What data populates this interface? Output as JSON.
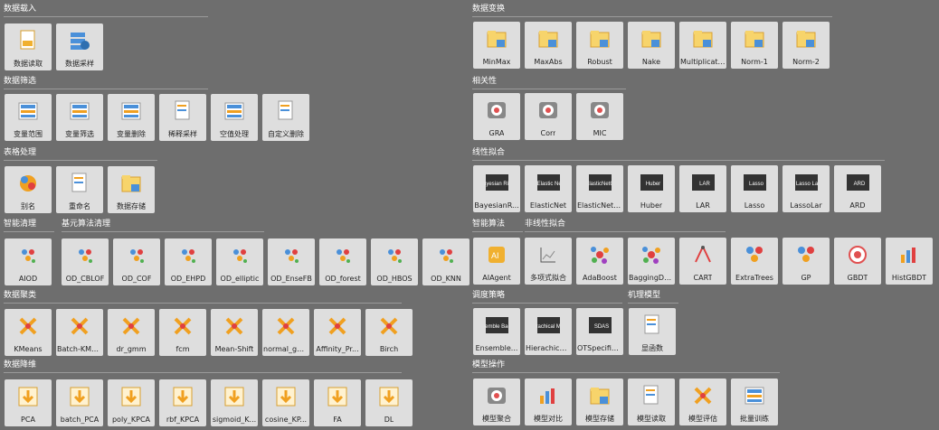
{
  "sections": {
    "load": {
      "title": "数据载入",
      "items": [
        "数据读取",
        "数据采样"
      ]
    },
    "filter": {
      "title": "数据筛选",
      "items": [
        "变量范围",
        "变量筛选",
        "变量删除",
        "稀释采样",
        "空值处理",
        "自定义删除"
      ]
    },
    "table": {
      "title": "表格处理",
      "items": [
        "别名",
        "重命名",
        "数据存储"
      ]
    },
    "smartclean": {
      "title": "智能清理",
      "items": [
        "AIOD"
      ]
    },
    "basecalc": {
      "title": "基元算法清理",
      "items": [
        "OD_CBLOF",
        "OD_COF",
        "OD_EHPD",
        "OD_elliptic",
        "OD_EnseFB",
        "OD_forest",
        "OD_HBOS",
        "OD_KNN"
      ]
    },
    "cluster": {
      "title": "数据聚类",
      "items": [
        "KMeans",
        "Batch-KMe...",
        "dr_gmm",
        "fcm",
        "Mean-Shift",
        "normal_gmm",
        "Affinity_Pr...",
        "Birch"
      ]
    },
    "reduce": {
      "title": "数据降维",
      "items": [
        "PCA",
        "batch_PCA",
        "poly_KPCA",
        "rbf_KPCA",
        "sigmoid_K...",
        "cosine_KP...",
        "FA",
        "DL"
      ]
    },
    "transform": {
      "title": "数据变换",
      "items": [
        "MinMax",
        "MaxAbs",
        "Robust",
        "Nake",
        "Multiplication",
        "Norm-1",
        "Norm-2"
      ]
    },
    "corr": {
      "title": "相关性",
      "items": [
        "GRA",
        "Corr",
        "MIC"
      ]
    },
    "linear": {
      "title": "线性拟合",
      "items": [
        "BayesianR...",
        "ElasticNet",
        "ElasticNetCV",
        "Huber",
        "LAR",
        "Lasso",
        "LassoLar",
        "ARD"
      ],
      "icon_text": [
        "Bayesian Ridge",
        "Elastic Net",
        "ElasticNetCV",
        "Huber",
        "LAR",
        "Lasso",
        "Lasso Lar",
        "ARD"
      ]
    },
    "smartalg": {
      "title": "智能算法",
      "items": [
        "AIAgent"
      ]
    },
    "nonlinear": {
      "title": "非线性拟合",
      "items": [
        "多项式拟合",
        "AdaBoost",
        "BaggingDe...",
        "CART",
        "ExtraTrees",
        "GP",
        "GBDT",
        "HistGBDT"
      ]
    },
    "schedule": {
      "title": "调度策略",
      "items": [
        "Ensemble...",
        "Hierachical...",
        "OTSpecifie..."
      ],
      "icon_text": [
        "Ensemble Bagging",
        "Hierachical Modify",
        "SDAS"
      ]
    },
    "mechanism": {
      "title": "机理模型",
      "items": [
        "显函数"
      ]
    },
    "modelop": {
      "title": "模型操作",
      "items": [
        "模型聚合",
        "模型对比",
        "模型存储",
        "模型读取",
        "模型评估",
        "批量训练"
      ]
    }
  },
  "colors": {
    "background": "#6e6e6e",
    "tile": "#dedede",
    "title": "#ffffff",
    "orange": "#f0a020",
    "blue": "#4a90d9"
  }
}
